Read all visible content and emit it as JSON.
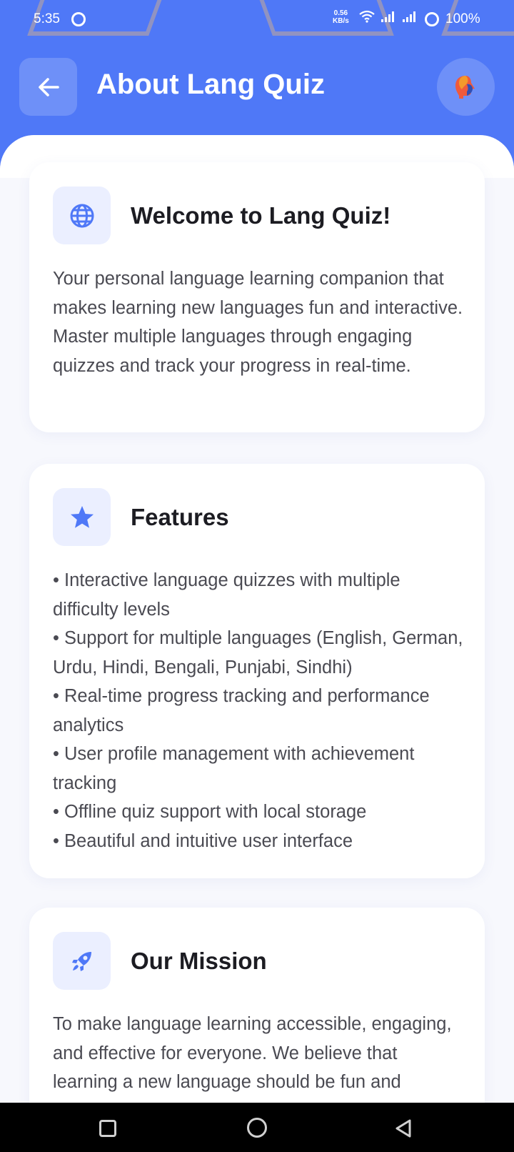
{
  "status_bar": {
    "time": "5:35",
    "speed_value": "0.56",
    "speed_unit": "KB/s",
    "battery": "100%"
  },
  "header": {
    "title": "About Lang Quiz",
    "back_icon": "arrow-left-icon",
    "avatar_icon": "app-logo-icon",
    "color": "#4f78f7"
  },
  "cards": [
    {
      "icon": "globe-icon",
      "title": "Welcome to Lang Quiz!",
      "body": "Your personal language learning companion that makes learning new languages fun and interactive. Master multiple languages through engaging quizzes and track your progress in real-time."
    },
    {
      "icon": "star-icon",
      "title": "Features",
      "items": [
        "• Interactive language quizzes with multiple difficulty levels",
        "• Support for multiple languages (English, German, Urdu, Hindi, Bengali, Punjabi, Sindhi)",
        "• Real-time progress tracking and performance analytics",
        "• User profile management with achievement tracking",
        "• Offline quiz support with local storage",
        "• Beautiful and intuitive user interface"
      ]
    },
    {
      "icon": "rocket-icon",
      "title": "Our Mission",
      "body": "To make language learning accessible, engaging, and effective for everyone. We believe that learning a new language should be fun and rewarding."
    }
  ],
  "colors": {
    "accent": "#4f78f7",
    "icon_bg": "#ebefff",
    "text": "#4a4a52"
  }
}
